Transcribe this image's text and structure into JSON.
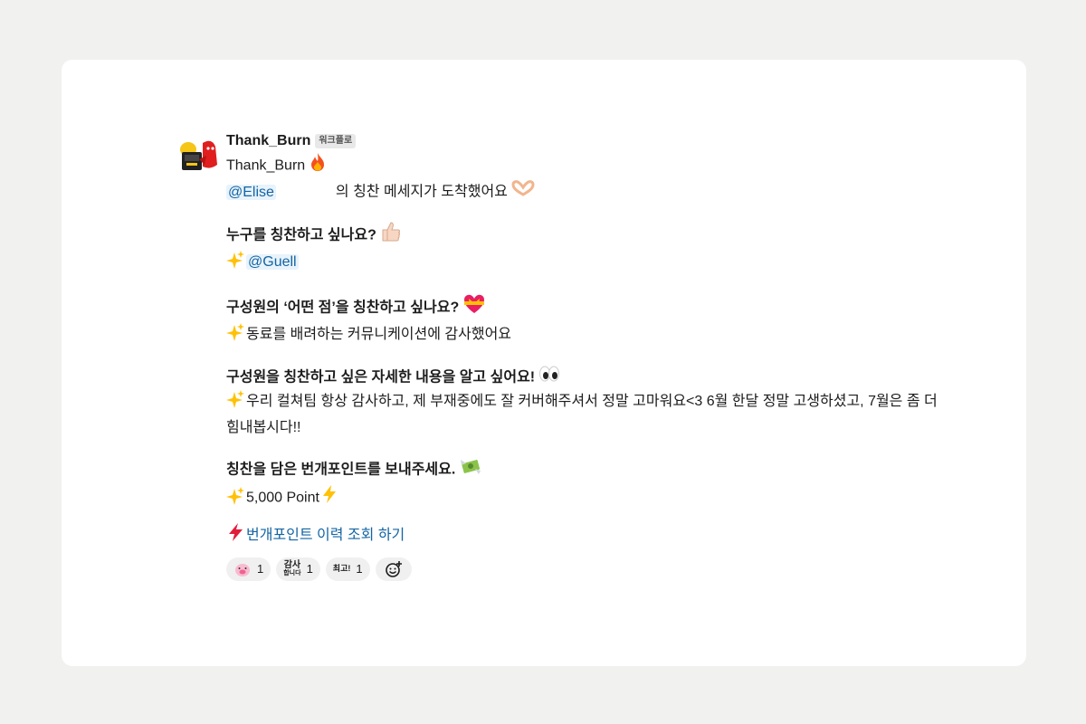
{
  "sender": {
    "name": "Thank_Burn",
    "badge": "워크플로"
  },
  "title": "Thank_Burn",
  "intro": {
    "mention": "@Elise",
    "text": "의 칭찬 메세지가 도착했어요"
  },
  "sections": [
    {
      "heading": "누구를 칭찬하고 싶나요?",
      "mention": "@Guell"
    },
    {
      "heading": "구성원의 ‘어떤 점’을 칭찬하고 싶나요?",
      "text": "동료를 배려하는 커뮤니케이션에 감사했어요"
    },
    {
      "heading": "구성원을 칭찬하고 싶은 자세한 내용을 알고 싶어요!",
      "text": "우리 컬쳐팀 항상 감사하고, 제 부재중에도 잘 커버해주셔서 정말 고마워요<3 6월 한달 정말 고생하셨고, 7월은 좀 더 힘내봅시다!!"
    },
    {
      "heading": "칭찬을 담은 번개포인트를 보내주세요.",
      "text": "5,000 Point"
    }
  ],
  "history_link": "번개포인트 이력 조회 하기",
  "reactions": [
    {
      "icon": "pig-emoji-icon",
      "count": "1"
    },
    {
      "icon": "thanks-sticker-icon",
      "label_top": "감사",
      "label_bottom": "합니다",
      "count": "1"
    },
    {
      "icon": "best-sticker-icon",
      "label": "최고!",
      "count": "1"
    }
  ],
  "colors": {
    "link": "#1264a3",
    "mention_bg": "#e8f3fb",
    "background": "#f1f1ef"
  }
}
